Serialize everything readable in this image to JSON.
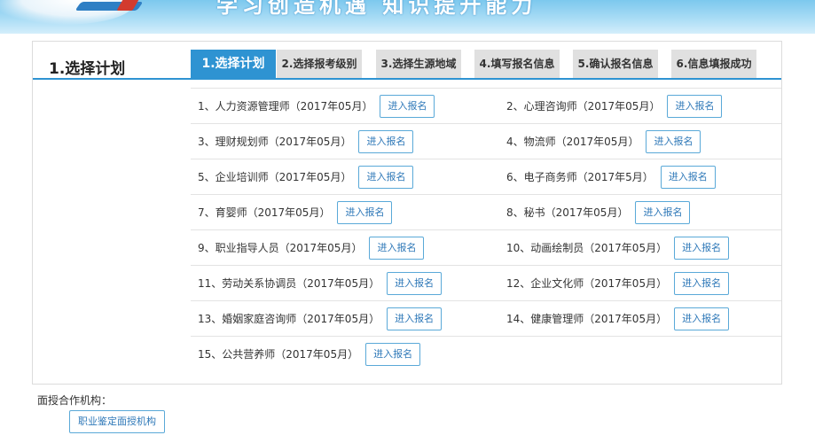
{
  "banner": {
    "slogan": "学习创造机遇 知识提升能力"
  },
  "panel": {
    "title": "1.选择计划",
    "tabs": [
      {
        "label": "1.选择计划",
        "active": true
      },
      {
        "label": "2.选择报考级别",
        "active": false
      },
      {
        "label": "3.选择生源地域",
        "active": false
      },
      {
        "label": "4.填写报名信息",
        "active": false
      },
      {
        "label": "5.确认报名信息",
        "active": false
      },
      {
        "label": "6.信息填报成功",
        "active": false
      }
    ],
    "enroll_label": "进入报名",
    "plans": [
      {
        "name": "1、人力资源管理师（2017年05月）"
      },
      {
        "name": "2、心理咨询师（2017年05月）"
      },
      {
        "name": "3、理财规划师（2017年05月）"
      },
      {
        "name": "4、物流师（2017年05月）"
      },
      {
        "name": "5、企业培训师（2017年05月）"
      },
      {
        "name": "6、电子商务师（2017年5月）"
      },
      {
        "name": "7、育婴师（2017年05月）"
      },
      {
        "name": "8、秘书（2017年05月）"
      },
      {
        "name": "9、职业指导人员（2017年05月）"
      },
      {
        "name": "10、动画绘制员（2017年05月）"
      },
      {
        "name": "11、劳动关系协调员（2017年05月）"
      },
      {
        "name": "12、企业文化师（2017年05月）"
      },
      {
        "name": "13、婚姻家庭咨询师（2017年05月）"
      },
      {
        "name": "14、健康管理师（2017年05月）"
      },
      {
        "name": "15、公共营养师（2017年05月）"
      }
    ]
  },
  "partner": {
    "label": "面授合作机构：",
    "button_label": "职业鉴定面授机构"
  }
}
